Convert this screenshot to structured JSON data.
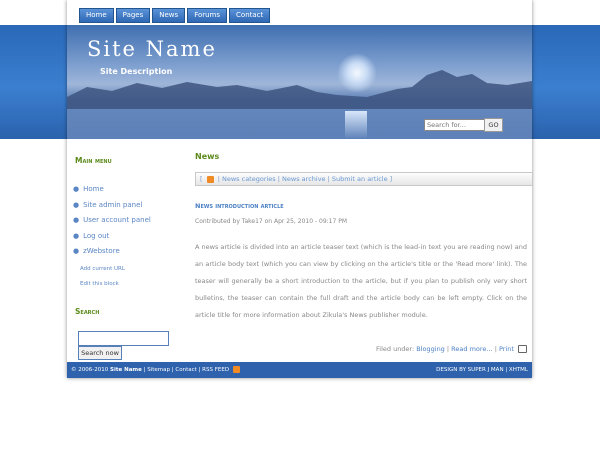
{
  "nav": {
    "items": [
      "Home",
      "Pages",
      "News",
      "Forums",
      "Contact"
    ]
  },
  "header": {
    "site_name": "Site Name",
    "site_description": "Site Description",
    "search_placeholder": "Search for...",
    "go_label": "GO"
  },
  "sidebar": {
    "main_menu_title": "Main menu",
    "items": [
      "Home",
      "Site admin panel",
      "User account panel",
      "Log out",
      "zWebstore"
    ],
    "sub_links": [
      "Add current URL",
      "Edit this block"
    ],
    "search_title": "Search",
    "search_button": "Search now"
  },
  "main": {
    "title": "News",
    "links": {
      "open": "[",
      "categories": "News categories",
      "archive": "News archive",
      "submit": "Submit an article",
      "close": "]",
      "sep": "|"
    },
    "article": {
      "title": "News introduction article",
      "meta": "Contributed by Take17 on Apr 25, 2010 - 09:17 PM",
      "body": "A news article is divided into an article teaser text (which is the lead-in text you are reading now) and an article body text (which you can view by clicking on the article's title or the 'Read more' link). The teaser will generally be a short introduction to the article, but if you plan to publish only very short bulletins, the teaser can contain the full draft and the article body can be left empty. Click on the article title for more information about Zikula's News publisher module.",
      "filed_label": "Filed under:",
      "filed_category": "Blogging",
      "read_more": "Read more...",
      "print": "Print"
    }
  },
  "footer": {
    "copyright": "© 2006-2010",
    "site_name": "Site Name",
    "links": [
      "Sitemap",
      "Contact",
      "RSS FEED"
    ],
    "sep": "|",
    "design_by": "DESIGN BY SUPER J MAN",
    "xhtml": "XHTML"
  },
  "colors": {
    "accent": "#2e62ad",
    "heading_green": "#5c8a1a",
    "link_blue": "#4a7fc4"
  }
}
